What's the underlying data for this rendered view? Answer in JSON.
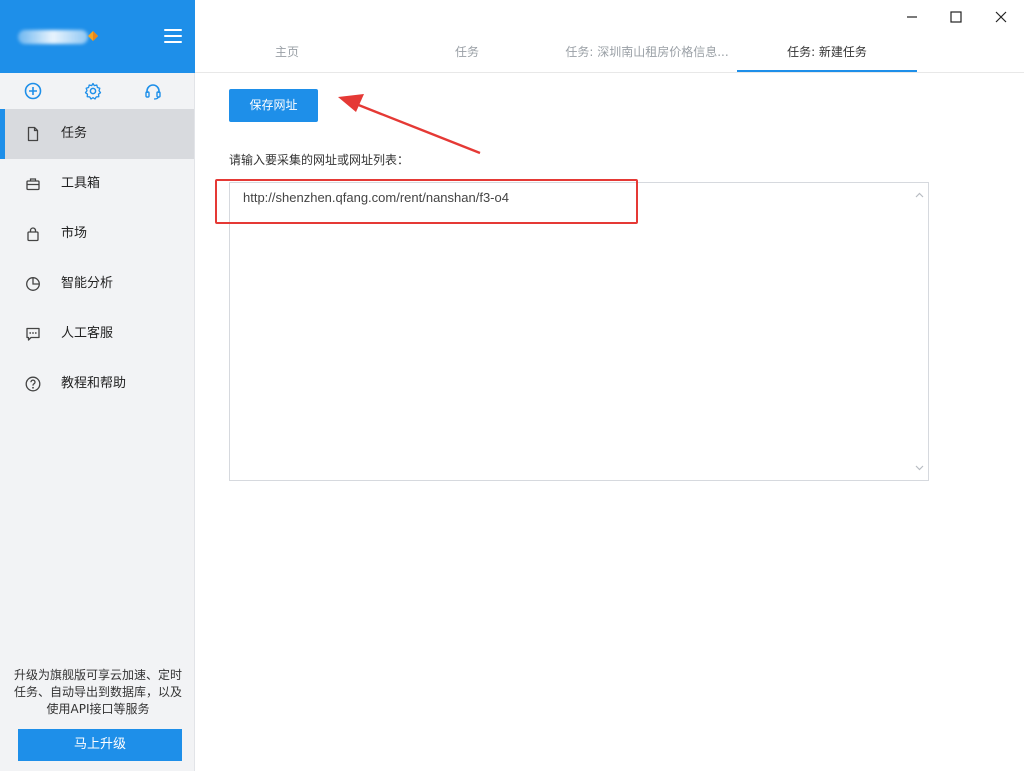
{
  "sidebar": {
    "items": [
      {
        "label": "任务",
        "icon": "document-icon",
        "active": true
      },
      {
        "label": "工具箱",
        "icon": "toolbox-icon"
      },
      {
        "label": "市场",
        "icon": "shopping-bag-icon"
      },
      {
        "label": "智能分析",
        "icon": "pie-chart-icon"
      },
      {
        "label": "人工客服",
        "icon": "chat-icon"
      },
      {
        "label": "教程和帮助",
        "icon": "help-circle-icon"
      }
    ],
    "quick_icons": [
      "plus-circle-icon",
      "gear-icon",
      "headset-icon"
    ],
    "upgrade_text": "升级为旗舰版可享云加速、定时任务、自动导出到数据库，以及使用API接口等服务",
    "upgrade_button": "马上升级"
  },
  "tabs": [
    {
      "label": "主页"
    },
    {
      "label": "任务"
    },
    {
      "label": "任务: 深圳南山租房价格信息..."
    },
    {
      "label": "任务: 新建任务",
      "active": true
    }
  ],
  "main": {
    "save_button": "保存网址",
    "prompt": "请输入要采集的网址或网址列表：",
    "url_value": "http://shenzhen.qfang.com/rent/nanshan/f3-o4"
  },
  "colors": {
    "accent": "#1e8fe9",
    "annotation": "#e53935",
    "sidebar_bg": "#f2f3f5"
  }
}
